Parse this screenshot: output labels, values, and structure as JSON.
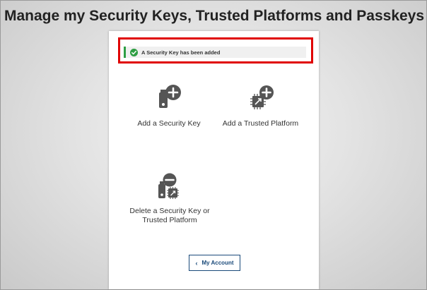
{
  "page": {
    "title": "Manage my Security Keys, Trusted Platforms and Passkeys"
  },
  "alert": {
    "message": "A Security Key has been added",
    "status_color": "#2e9e43"
  },
  "tiles": {
    "add_key": {
      "label": "Add a Security Key",
      "icon": "add-security-key-icon"
    },
    "add_platform": {
      "label": "Add a Trusted Platform",
      "icon": "add-trusted-platform-icon"
    },
    "delete": {
      "label_line1": "Delete a Security Key or",
      "label_line2": "Trusted Platform",
      "icon": "delete-key-platform-icon"
    }
  },
  "footer": {
    "account_button": "My Account",
    "chevron": "‹"
  },
  "colors": {
    "highlight": "#e00000",
    "button_text": "#1a4a7a",
    "icon": "#555555"
  }
}
